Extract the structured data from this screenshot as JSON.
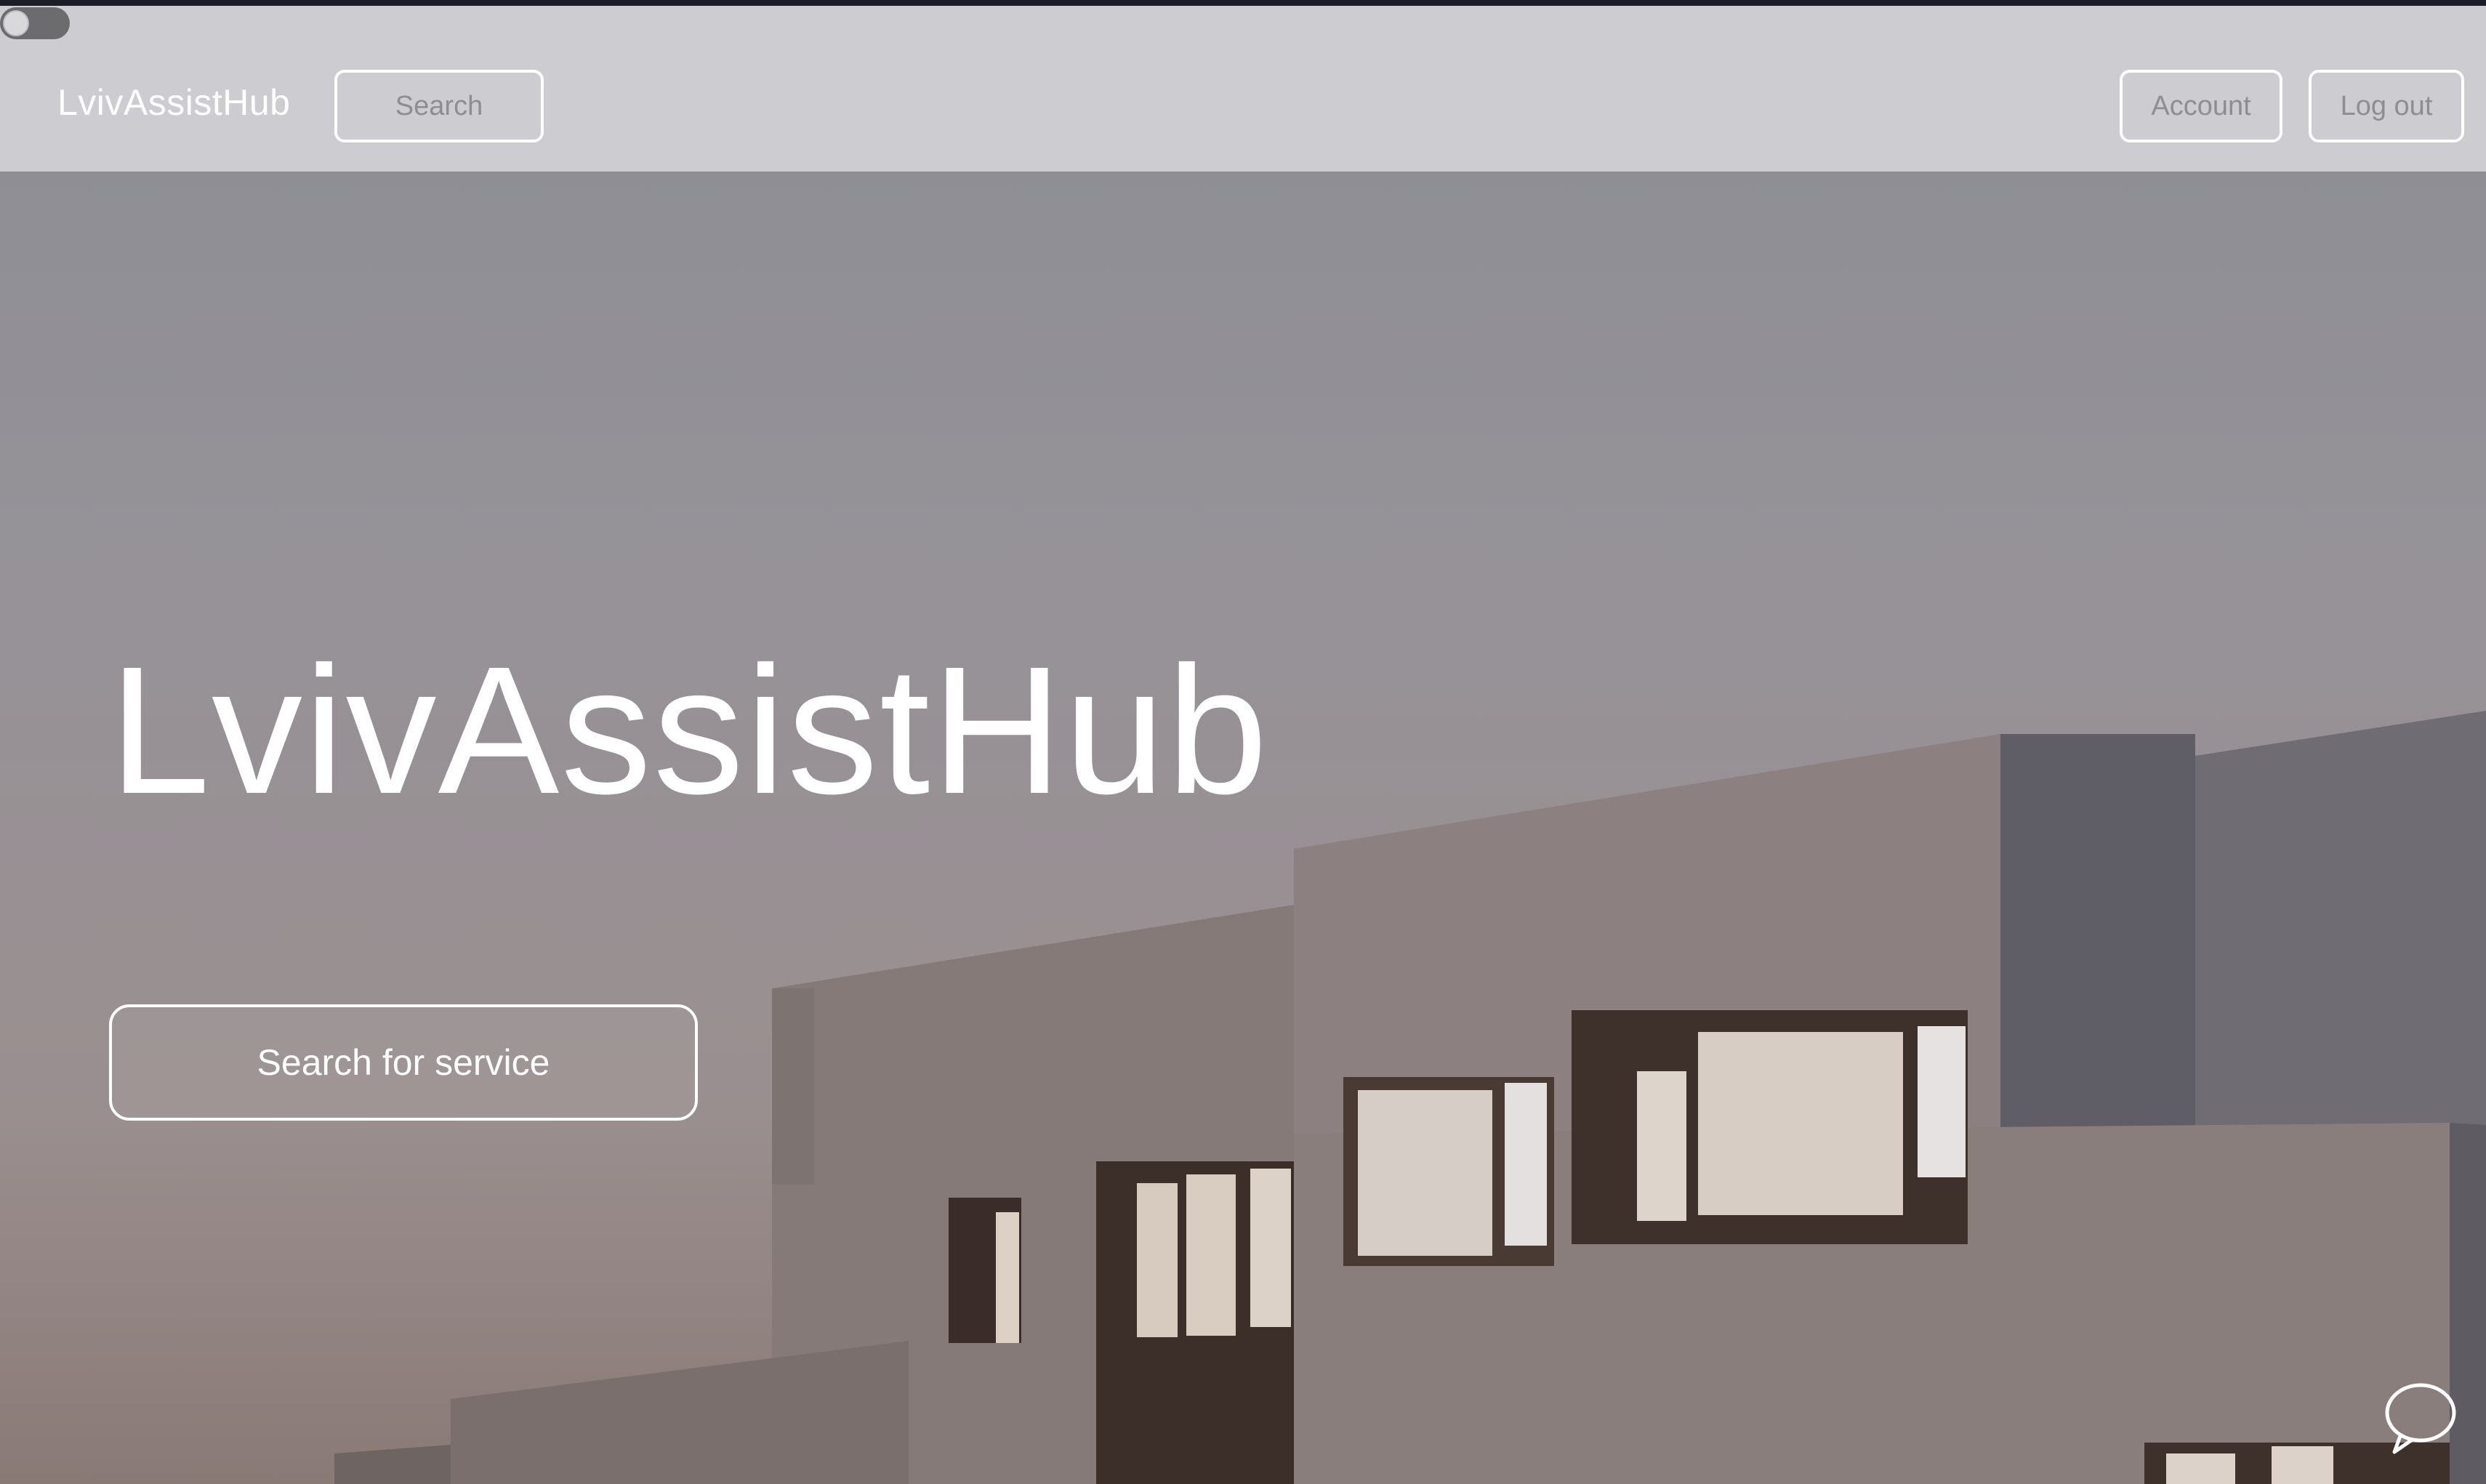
{
  "navbar": {
    "brand": "LvivAssistHub",
    "search_label": "Search",
    "account_label": "Account",
    "logout_label": "Log out"
  },
  "hero": {
    "title": "LvivAssistHub",
    "cta_label": "Search for service"
  },
  "icons": {
    "theme_toggle": "toggle-switch-icon",
    "chat": "chat-bubble-icon"
  },
  "colors": {
    "navbar_bg": "#d2d2d6",
    "button_border": "#ffffff",
    "nav_text": "#8d8d92",
    "hero_text": "#ffffff"
  }
}
